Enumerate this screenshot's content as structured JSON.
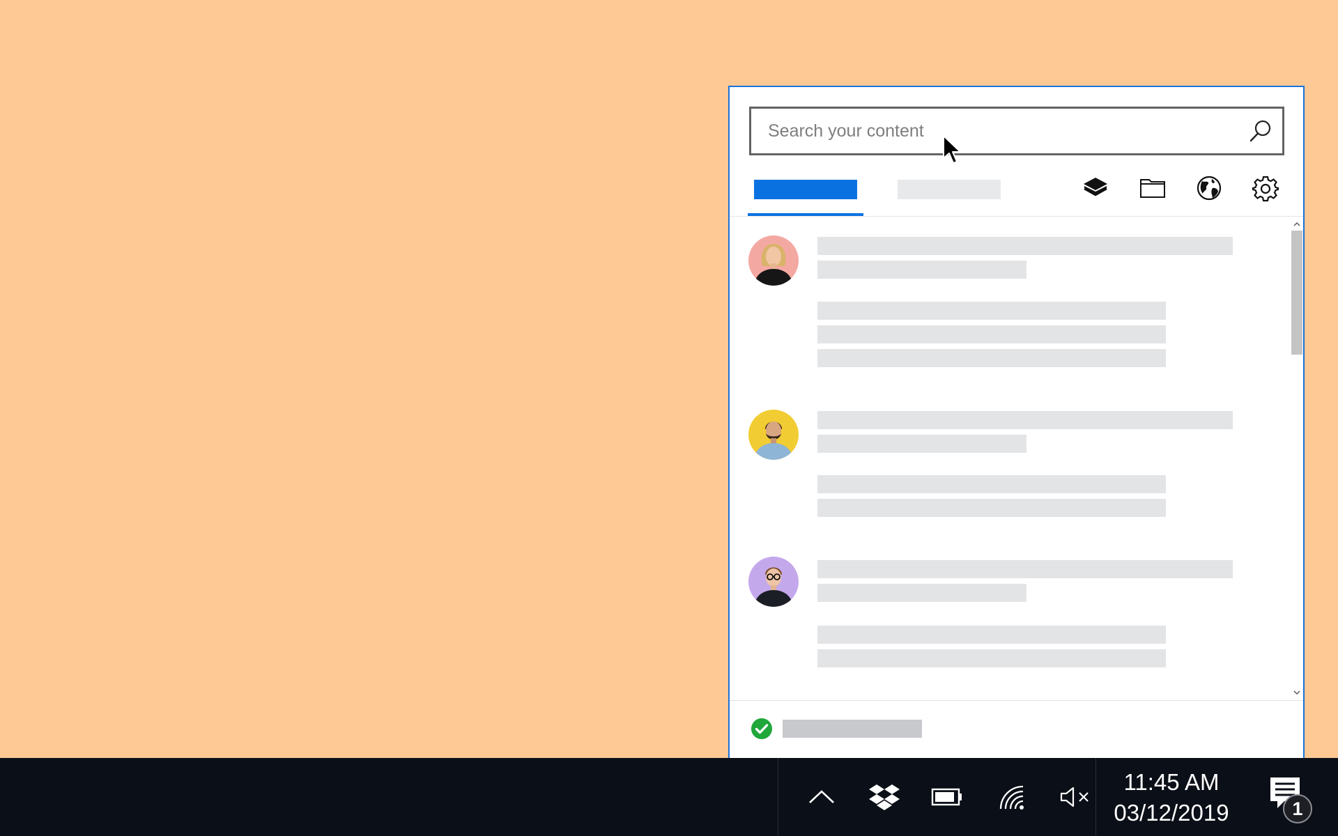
{
  "colors": {
    "desktop_background": "#fec995",
    "accent": "#0a72e0",
    "taskbar_background": "#0b0f17",
    "sync_ok": "#1fa73a"
  },
  "search": {
    "placeholder": "Search your content",
    "value": "",
    "icon": "search-icon"
  },
  "toolbar": {
    "icons": [
      "layers-icon",
      "folder-icon",
      "globe-icon",
      "gear-icon"
    ]
  },
  "feed": {
    "items": [
      {
        "avatar": "person-avatar",
        "avatar_bg": "#f4a8a2",
        "body_lines": 3
      },
      {
        "avatar": "person-avatar",
        "avatar_bg": "#f2cc33",
        "body_lines": 2
      },
      {
        "avatar": "person-avatar",
        "avatar_bg": "#c4a8ec",
        "body_lines": 2
      }
    ]
  },
  "footer": {
    "status_icon": "check-circle-icon"
  },
  "taskbar": {
    "tray_icons": [
      "chevron-up-icon",
      "dropbox-icon",
      "battery-icon",
      "wifi-icon",
      "volume-muted-icon"
    ],
    "time": "11:45 AM",
    "date": "03/12/2019",
    "notification_count": "1"
  }
}
